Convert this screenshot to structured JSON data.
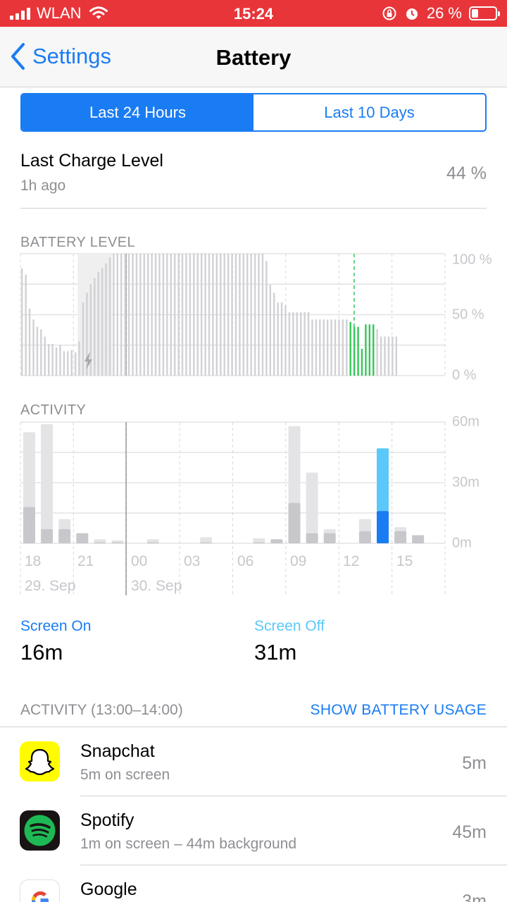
{
  "status_bar": {
    "carrier": "WLAN",
    "time": "15:24",
    "battery_percent": "26 %"
  },
  "nav": {
    "back_label": "Settings",
    "title": "Battery"
  },
  "segments": [
    {
      "label": "Last 24 Hours",
      "active": true
    },
    {
      "label": "Last 10 Days",
      "active": false
    }
  ],
  "last_charge": {
    "title": "Last Charge Level",
    "time_ago": "1h ago",
    "value": "44 %"
  },
  "battery_chart": {
    "section_label": "BATTERY LEVEL",
    "y_ticks": [
      "100 %",
      "50 %",
      "0 %"
    ]
  },
  "activity_chart": {
    "section_label": "ACTIVITY",
    "y_ticks": [
      "60m",
      "30m",
      "0m"
    ],
    "x_ticks": [
      "18",
      "21",
      "00",
      "03",
      "06",
      "09",
      "12",
      "15"
    ],
    "date_labels": [
      "29. Sep",
      "30. Sep"
    ]
  },
  "chart_data": [
    {
      "type": "bar",
      "ylabel": "BATTERY LEVEL",
      "ylim": [
        0,
        100
      ],
      "y_unit": "%",
      "x_ticks": [
        "18",
        "21",
        "00",
        "03",
        "06",
        "09",
        "12",
        "15"
      ],
      "values": [
        88,
        83,
        55,
        46,
        40,
        38,
        32,
        26,
        26,
        23,
        25,
        20,
        20,
        21,
        19,
        28,
        60,
        68,
        75,
        80,
        85,
        88,
        92,
        97,
        100,
        100,
        100,
        100,
        100,
        100,
        100,
        100,
        100,
        100,
        100,
        100,
        100,
        100,
        100,
        100,
        100,
        100,
        100,
        100,
        100,
        100,
        100,
        100,
        100,
        100,
        100,
        100,
        100,
        100,
        100,
        100,
        100,
        100,
        100,
        100,
        100,
        100,
        100,
        100,
        94,
        75,
        68,
        60,
        60,
        58,
        52,
        52,
        52,
        52,
        52,
        52,
        46,
        46,
        46,
        46,
        46,
        46,
        46,
        46,
        46,
        46,
        44,
        40,
        40,
        22,
        42,
        42,
        42,
        38,
        32,
        32,
        32,
        32,
        32
      ],
      "charging_window": [
        15,
        24
      ],
      "charging_segments": [
        [
          86,
          93
        ]
      ]
    },
    {
      "type": "bar",
      "ylabel": "ACTIVITY",
      "ylim": [
        0,
        60
      ],
      "y_unit": "m",
      "categories": [
        "17",
        "18",
        "19",
        "20",
        "21",
        "22",
        "23",
        "00",
        "01",
        "02",
        "03",
        "04",
        "05",
        "06",
        "07",
        "08",
        "09",
        "10",
        "11",
        "12",
        "13",
        "14",
        "15"
      ],
      "series": [
        {
          "name": "Screen On",
          "values": [
            18,
            7,
            7,
            5,
            0.5,
            0.5,
            0,
            0.5,
            0,
            0,
            0.5,
            0,
            0,
            0.5,
            2,
            20,
            5,
            5,
            0,
            6,
            16,
            6,
            4
          ]
        },
        {
          "name": "Screen Off",
          "values": [
            37,
            52,
            5,
            0,
            1.5,
            1,
            0,
            1.5,
            0,
            0,
            2.5,
            0,
            0,
            2,
            0,
            38,
            30,
            2,
            0,
            6,
            31,
            2,
            0
          ]
        }
      ],
      "highlight_category": "13"
    }
  ],
  "totals": {
    "screen_on_label": "Screen On",
    "screen_on_value": "16m",
    "screen_off_label": "Screen Off",
    "screen_off_value": "31m",
    "on_color": "#1a7cf3",
    "off_color": "#5ac8fa"
  },
  "activity_list": {
    "header_label": "ACTIVITY (13:00–14:00)",
    "show_usage_label": "SHOW BATTERY USAGE",
    "apps": [
      {
        "name": "Snapchat",
        "detail": "5m on screen",
        "time": "5m",
        "icon": "snapchat-icon",
        "color": "#fffc00"
      },
      {
        "name": "Spotify",
        "detail": "1m on screen – 44m background",
        "time": "45m",
        "icon": "spotify-icon",
        "color": "#1db954"
      },
      {
        "name": "Google",
        "detail": "",
        "time": "3m",
        "icon": "google-icon",
        "color": "#4285f4"
      }
    ]
  }
}
